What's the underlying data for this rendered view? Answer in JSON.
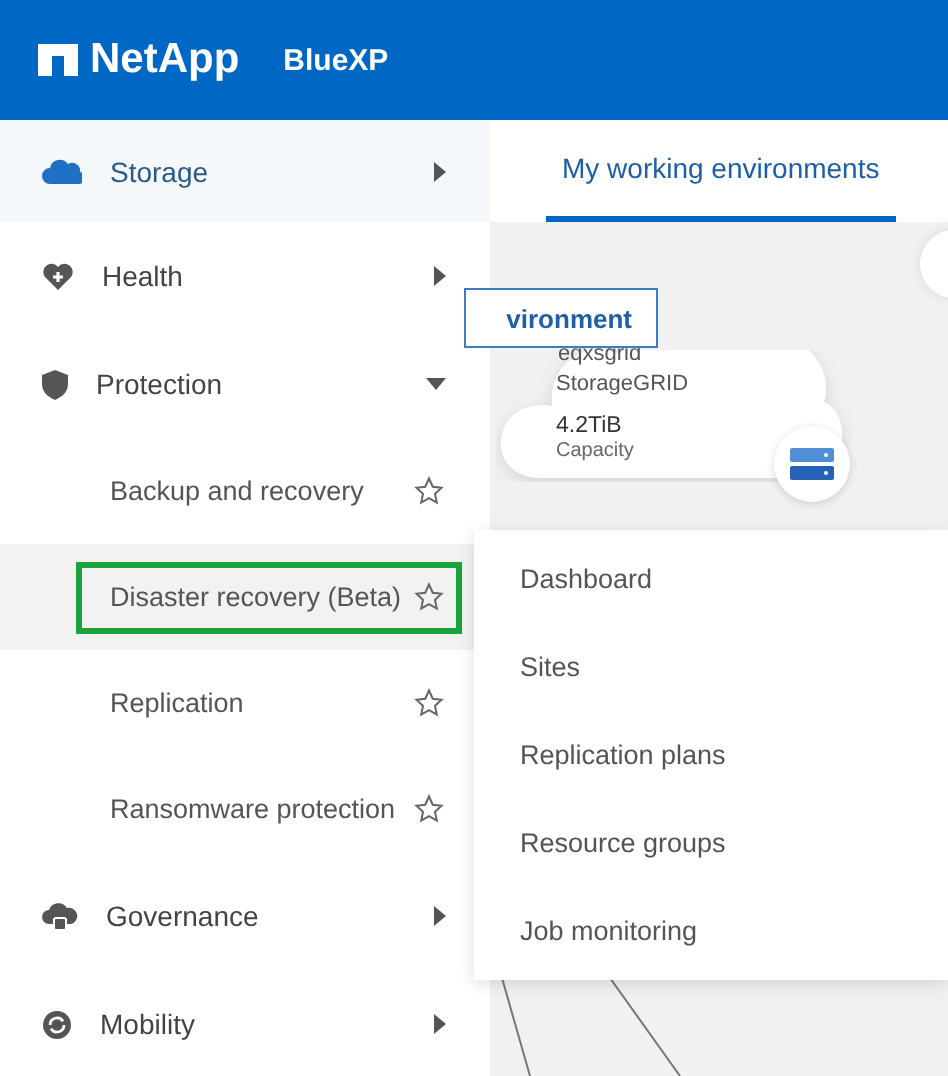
{
  "header": {
    "brand": "NetApp",
    "product": "BlueXP"
  },
  "sidebar": {
    "items": [
      {
        "kind": "section",
        "label": "Storage",
        "active": true,
        "expanded": false
      },
      {
        "kind": "section",
        "label": "Health",
        "active": false,
        "expanded": false
      },
      {
        "kind": "section",
        "label": "Protection",
        "active": false,
        "expanded": true,
        "children": [
          {
            "label": "Backup and recovery",
            "highlighted": false,
            "favorite": false
          },
          {
            "label": "Disaster recovery (Beta)",
            "highlighted": true,
            "favorite": false
          },
          {
            "label": "Replication",
            "highlighted": false,
            "favorite": false
          },
          {
            "label": "Ransomware protection",
            "highlighted": false,
            "favorite": false
          }
        ]
      },
      {
        "kind": "section",
        "label": "Governance",
        "active": false,
        "expanded": false
      },
      {
        "kind": "section",
        "label": "Mobility",
        "active": false,
        "expanded": false
      }
    ]
  },
  "tabs": [
    {
      "label": "My working environments",
      "selected": true
    }
  ],
  "canvas": {
    "add_button": "vironment",
    "environment": {
      "name": "eqxsgrid",
      "type": "StorageGRID",
      "capacity": "4.2TiB",
      "capacity_label": "Capacity"
    }
  },
  "flyout": {
    "items": [
      "Dashboard",
      "Sites",
      "Replication plans",
      "Resource groups",
      "Job monitoring"
    ]
  }
}
